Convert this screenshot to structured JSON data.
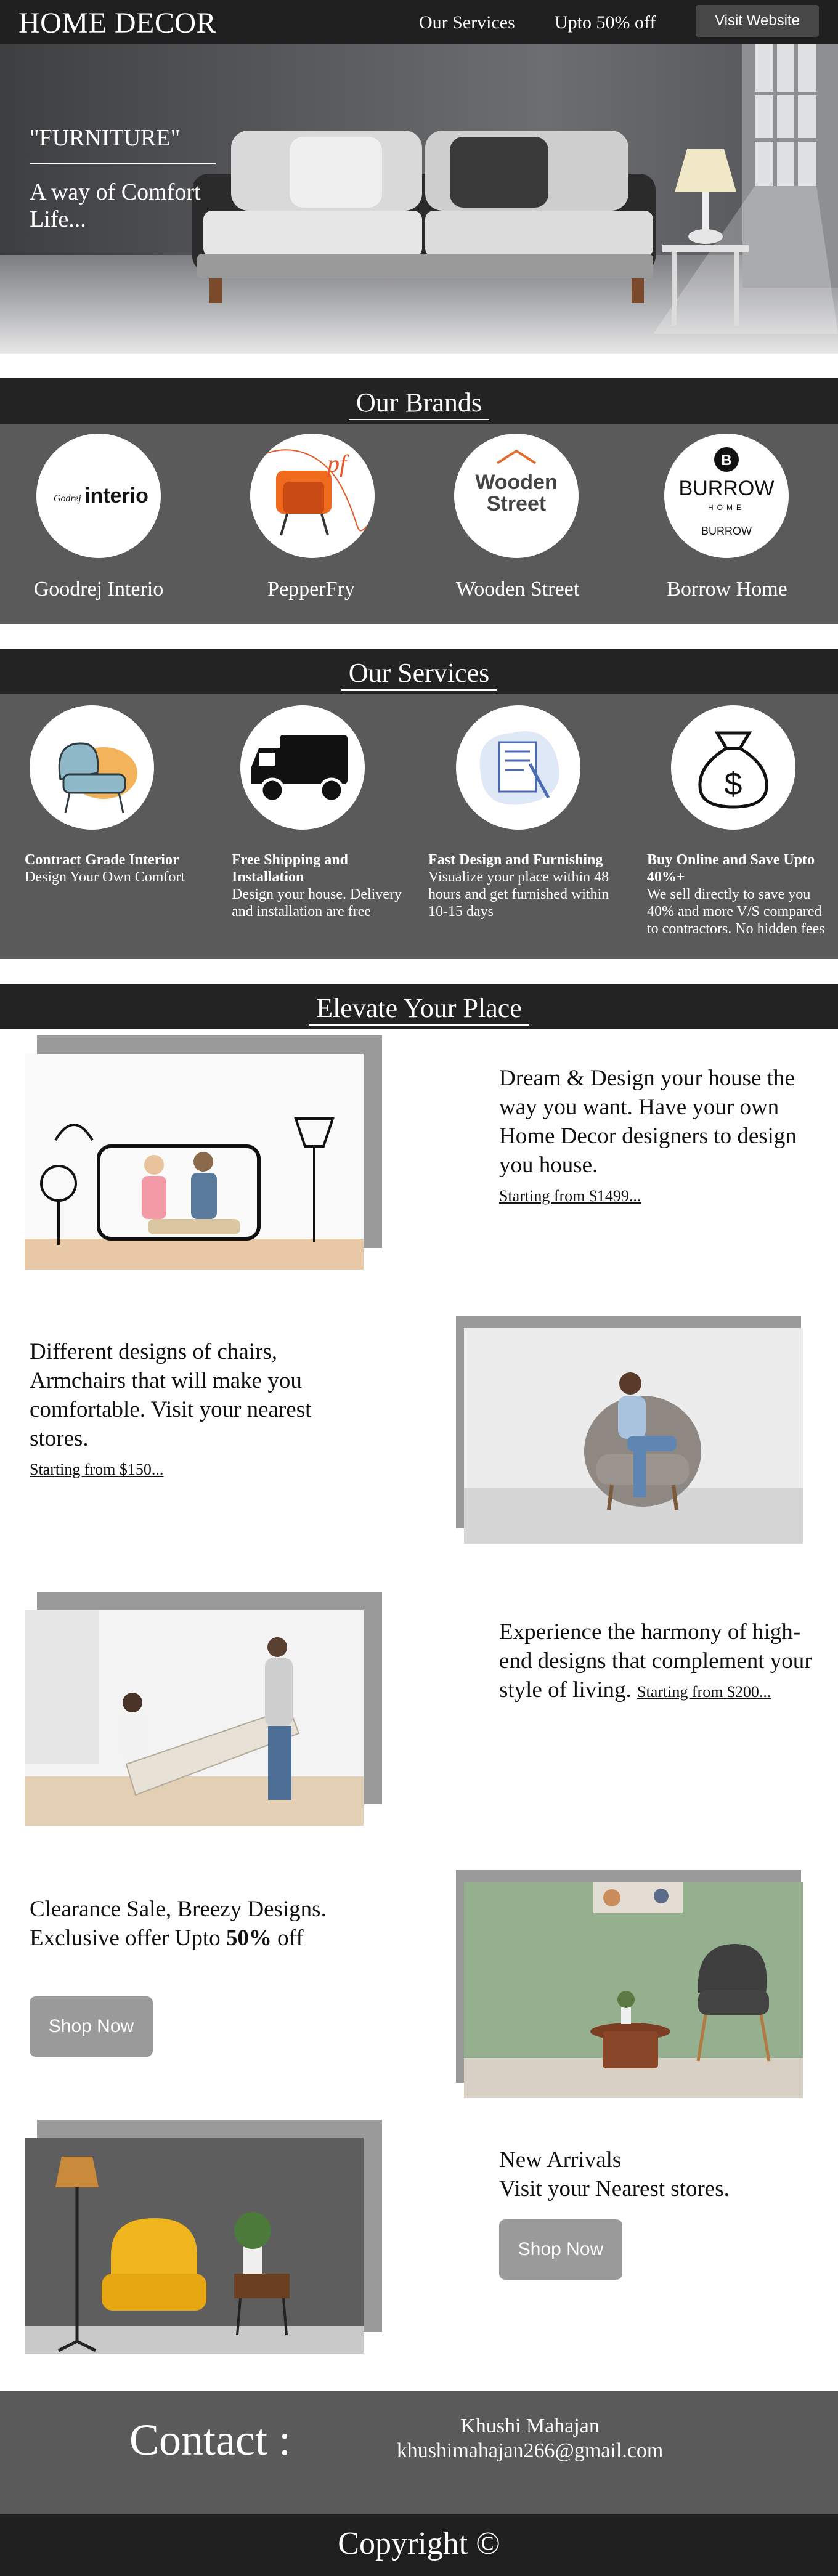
{
  "nav": {
    "brand": "HOME DECOR",
    "links": [
      "Our Services",
      "Upto 50% off"
    ],
    "button": "Visit Website"
  },
  "hero": {
    "title": "\"FURNITURE\"",
    "subtitle_line1": "A way of Comfort",
    "subtitle_line2": "Life..."
  },
  "brands": {
    "heading": "Our Brands",
    "items": [
      {
        "label": "Goodrej Interio",
        "logo_text": "interio"
      },
      {
        "label": "PepperFry",
        "logo_text": "pf"
      },
      {
        "label": "Wooden Street",
        "logo_text1": "Wooden",
        "logo_text2": "Street"
      },
      {
        "label": "Borrow Home",
        "logo_text1": "BURROW",
        "logo_text2": "HOME",
        "logo_text3": "BURROW"
      }
    ]
  },
  "services": {
    "heading": "Our Services",
    "items": [
      {
        "title": "Contract Grade Interior",
        "desc": "Design Your Own Comfort"
      },
      {
        "title": "Free Shipping and Installation",
        "desc": "Design your house. Delivery and installation are free"
      },
      {
        "title": "Fast Design and Furnishing",
        "desc": "Visualize your place within 48 hours and get furnished within 10-15 days"
      },
      {
        "title": "Buy Online and Save Upto 40%+",
        "desc": "We sell directly to save you 40% and more V/S compared to contractors. No hidden fees"
      }
    ]
  },
  "elevate": {
    "heading": "Elevate Your Place",
    "blocks": [
      {
        "text": "Dream & Design your house the way you want. Have your own Home Decor designers to design you house.",
        "link": "Starting from $1499..."
      },
      {
        "text": "Different designs of chairs, Armchairs that will make you comfortable. Visit your nearest stores.",
        "link": "Starting from $150..."
      },
      {
        "text": "Experience the harmony of high-end designs that complement your style of living.",
        "link": "Starting from $200..."
      },
      {
        "line1": "Clearance Sale, Breezy Designs.",
        "line2_pre": "Exclusive offer Upto ",
        "line2_bold": "50%",
        "line2_post": " off",
        "button": "Shop Now"
      },
      {
        "line1": "New Arrivals",
        "line2": "Visit your Nearest stores.",
        "button": "Shop Now"
      }
    ]
  },
  "contact": {
    "label": "Contact :",
    "name": "Khushi Mahajan",
    "email": "khushimahajan266@gmail.com"
  },
  "footer": {
    "copyright": "Copyright ©"
  }
}
